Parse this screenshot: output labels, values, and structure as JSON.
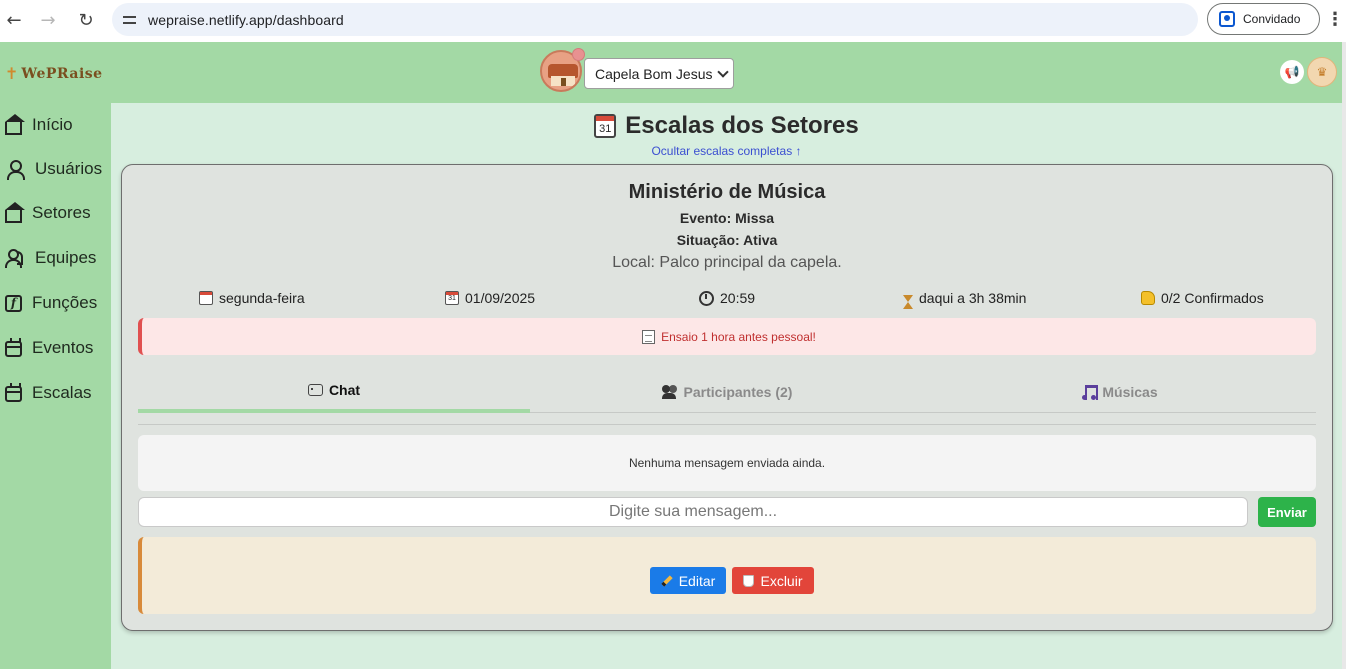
{
  "browser": {
    "url": "wepraise.netlify.app/dashboard",
    "profile_label": "Convidado"
  },
  "header": {
    "logo_text": "WePRaise",
    "chapel_selected": "Capela Bom Jesus"
  },
  "sidebar": {
    "items": [
      {
        "label": "Início",
        "icon": "home-icon"
      },
      {
        "label": "Usuários",
        "icon": "user-icon"
      },
      {
        "label": "Setores",
        "icon": "building-icon"
      },
      {
        "label": "Equipes",
        "icon": "users-icon"
      },
      {
        "label": "Funções",
        "icon": "function-icon"
      },
      {
        "label": "Eventos",
        "icon": "calendar-icon"
      },
      {
        "label": "Escalas",
        "icon": "calendar-icon"
      }
    ]
  },
  "main": {
    "title": "Escalas dos Setores",
    "toggle_link": "Ocultar escalas completas ↑",
    "card": {
      "ministry": "Ministério de Música",
      "event": "Evento: Missa",
      "status": "Situação: Ativa",
      "location": "Local: Palco principal da capela.",
      "weekday": "segunda-feira",
      "date": "01/09/2025",
      "time": "20:59",
      "countdown": "daqui a 3h 38min",
      "confirmed": "0/2 Confirmados",
      "notice": "Ensaio 1 hora antes pessoal!",
      "tabs": [
        {
          "label": "Chat",
          "active": true
        },
        {
          "label": "Participantes (2)",
          "active": false
        },
        {
          "label": "Músicas",
          "active": false
        }
      ],
      "empty_chat": "Nenhuma mensagem enviada ainda.",
      "message_placeholder": "Digite sua mensagem...",
      "send_label": "Enviar",
      "edit_label": "Editar",
      "delete_label": "Excluir"
    }
  },
  "colors": {
    "sidebar_bg": "#a3d9a5",
    "main_bg": "#d7eedf",
    "send": "#2db34a",
    "edit": "#1a7be8",
    "delete": "#e2453a"
  }
}
